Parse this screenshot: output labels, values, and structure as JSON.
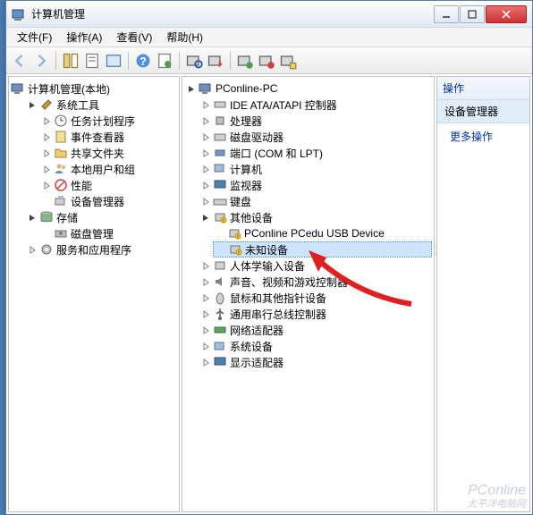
{
  "window": {
    "title": "计算机管理"
  },
  "menu": {
    "file": "文件(F)",
    "action": "操作(A)",
    "view": "查看(V)",
    "help": "帮助(H)"
  },
  "leftTree": {
    "root": "计算机管理(本地)",
    "sysTools": "系统工具",
    "scheduler": "任务计划程序",
    "eventViewer": "事件查看器",
    "sharedFolders": "共享文件夹",
    "localUsers": "本地用户和组",
    "performance": "性能",
    "deviceManager": "设备管理器",
    "storage": "存储",
    "diskMgmt": "磁盘管理",
    "services": "服务和应用程序"
  },
  "centerTree": {
    "pc": "PConline-PC",
    "ide": "IDE ATA/ATAPI 控制器",
    "cpu": "处理器",
    "diskDrives": "磁盘驱动器",
    "ports": "端口 (COM 和 LPT)",
    "computers": "计算机",
    "monitors": "监视器",
    "keyboards": "键盘",
    "other": "其他设备",
    "usbDevice": "PConline PCedu USB Device",
    "unknown": "未知设备",
    "hid": "人体学输入设备",
    "sound": "声音、视频和游戏控制器",
    "mouse": "鼠标和其他指针设备",
    "usb": "通用串行总线控制器",
    "network": "网络适配器",
    "system": "系统设备",
    "display": "显示适配器"
  },
  "rightPanel": {
    "header": "操作",
    "sub": "设备管理器",
    "action": "更多操作"
  },
  "watermark": {
    "main": "PConline",
    "sub": "太平洋电脑网"
  }
}
